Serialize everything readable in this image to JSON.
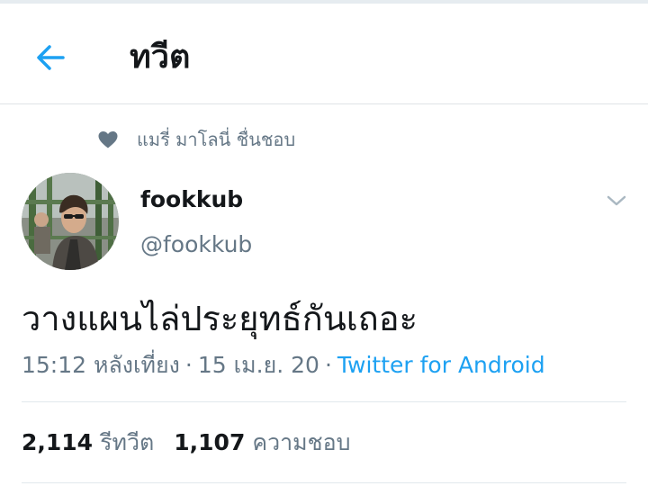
{
  "header": {
    "title": "ทวีต",
    "back_icon": "arrow-left-icon"
  },
  "social_context": {
    "icon": "heart-icon",
    "text": "แมรี่ มาโลนี่ ชื่นชอบ"
  },
  "author": {
    "display_name": "fookkub",
    "username": "@fookkub"
  },
  "tweet": {
    "text": "วางแผนไล่ประยุทธ์กันเถอะ",
    "time": "15:12 หลังเที่ยง",
    "date": "15 เม.ย. 20",
    "source": "Twitter for Android"
  },
  "stats": {
    "retweets_count": "2,114",
    "retweets_label": "รีทวีต",
    "likes_count": "1,107",
    "likes_label": "ความชอบ"
  },
  "colors": {
    "accent": "#1da1f2",
    "text_primary": "#14171a",
    "text_secondary": "#657786",
    "divider": "#e1e8ed"
  }
}
